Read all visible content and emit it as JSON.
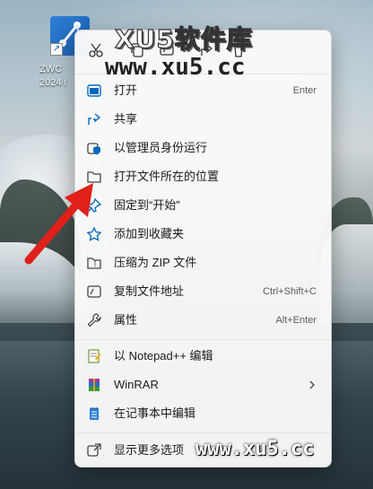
{
  "desktop": {
    "icon": {
      "label_line1": "ZWC",
      "label_line2": "2024 i"
    }
  },
  "context_menu": {
    "quick_actions": [
      {
        "icon": "cut-icon"
      },
      {
        "icon": "copy-icon"
      },
      {
        "icon": "rename-icon"
      },
      {
        "icon": "share-icon"
      },
      {
        "icon": "delete-icon"
      }
    ],
    "items": [
      {
        "label": "打开",
        "shortcut": "Enter",
        "icon": "open-icon"
      },
      {
        "label": "共享",
        "shortcut": "",
        "icon": "share-icon"
      },
      {
        "label": "以管理员身份运行",
        "shortcut": "",
        "icon": "admin-shield-icon"
      },
      {
        "label": "打开文件所在的位置",
        "shortcut": "",
        "icon": "folder-icon"
      },
      {
        "label": "固定到“开始”",
        "shortcut": "",
        "icon": "pin-icon"
      },
      {
        "label": "添加到收藏夹",
        "shortcut": "",
        "icon": "star-icon"
      },
      {
        "label": "压缩为 ZIP 文件",
        "shortcut": "",
        "icon": "zip-icon"
      },
      {
        "label": "复制文件地址",
        "shortcut": "Ctrl+Shift+C",
        "icon": "copy-path-icon"
      },
      {
        "label": "属性",
        "shortcut": "Alt+Enter",
        "icon": "wrench-icon"
      }
    ],
    "app_items": [
      {
        "label": "以 Notepad++ 编辑",
        "icon": "notepadpp-icon"
      },
      {
        "label": "WinRAR",
        "icon": "winrar-icon",
        "has_submenu": true
      },
      {
        "label": "在记事本中编辑",
        "icon": "notepad-icon"
      }
    ],
    "more": {
      "label": "显示更多选项",
      "shortcut": "",
      "icon": "more-options-icon"
    }
  },
  "watermark": {
    "title": "XU5软件库",
    "url_top": "www.xu5.cc",
    "url_bottom": "www.xu5.cc"
  },
  "colors": {
    "accent": "#0067c0",
    "arrow": "#e0201b"
  }
}
